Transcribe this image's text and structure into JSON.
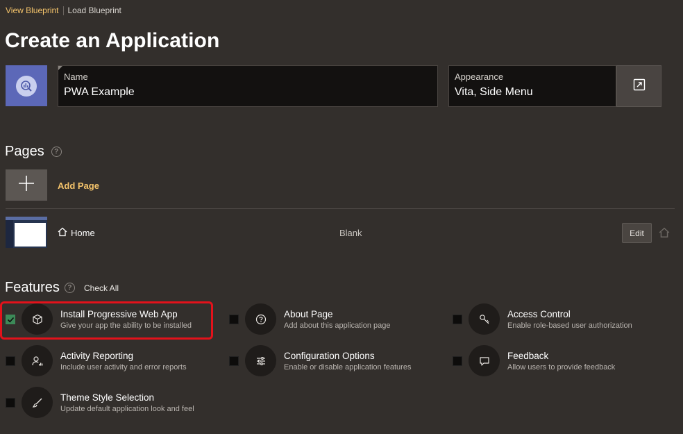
{
  "tabs": {
    "active": "View Blueprint",
    "other": "Load Blueprint"
  },
  "page_title": "Create an Application",
  "app": {
    "icon": "app-chart-search-icon",
    "accent": "#5c68b8",
    "name_label": "Name",
    "name_value": "PWA Example",
    "appearance_label": "Appearance",
    "appearance_value": "Vita, Side Menu",
    "appearance_button_icon": "open-dialog-icon"
  },
  "pages": {
    "title": "Pages",
    "add_label": "Add Page",
    "rows": [
      {
        "name": "Home",
        "type": "Blank",
        "edit_label": "Edit"
      }
    ]
  },
  "features": {
    "title": "Features",
    "check_all": "Check All",
    "items": [
      {
        "title": "Install Progressive Web App",
        "desc": "Give your app the ability to be installed",
        "checked": true,
        "icon": "package-icon"
      },
      {
        "title": "About Page",
        "desc": "Add about this application page",
        "checked": false,
        "icon": "question-icon"
      },
      {
        "title": "Access Control",
        "desc": "Enable role-based user authorization",
        "checked": false,
        "icon": "key-icon"
      },
      {
        "title": "Activity Reporting",
        "desc": "Include user activity and error reports",
        "checked": false,
        "icon": "user-chart-icon"
      },
      {
        "title": "Configuration Options",
        "desc": "Enable or disable application features",
        "checked": false,
        "icon": "sliders-icon"
      },
      {
        "title": "Feedback",
        "desc": "Allow users to provide feedback",
        "checked": false,
        "icon": "comment-icon"
      },
      {
        "title": "Theme Style Selection",
        "desc": "Update default application look and feel",
        "checked": false,
        "icon": "brush-icon"
      }
    ]
  },
  "colors": {
    "background": "#332f2c",
    "link": "#f5c46b",
    "checked": "#3c8a58",
    "highlight": "#e3121b"
  }
}
